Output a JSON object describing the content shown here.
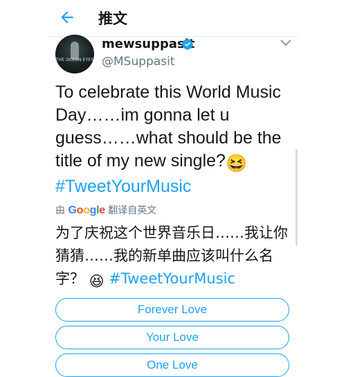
{
  "header": {
    "title": "推文"
  },
  "tweet": {
    "display_name": "mewsuppasit",
    "handle": "@MSuppasit",
    "avatar_caption": "THE OCEAN EYES",
    "text_main": "To celebrate this World Music Day……im gonna let u guess……what should be the title of my new single?",
    "emoji": "😆",
    "hashtag": "#TweetYourMusic",
    "translated_by_prefix": "由",
    "translated_by_suffix": "翻译自英文",
    "translated_text": "为了庆祝这个世界音乐日……我让你猜猜……我的新单曲应该叫什么名字？",
    "translated_hashtag": "#TweetYourMusic"
  },
  "poll": {
    "options": [
      {
        "label": "Forever Love"
      },
      {
        "label": "Your Love"
      },
      {
        "label": "One Love"
      }
    ]
  },
  "colors": {
    "accent": "#1da1f2",
    "secondary_text": "#657786"
  },
  "icons": {
    "back": "arrow-left-icon",
    "verified": "verified-badge-icon",
    "more": "chevron-down-icon"
  }
}
